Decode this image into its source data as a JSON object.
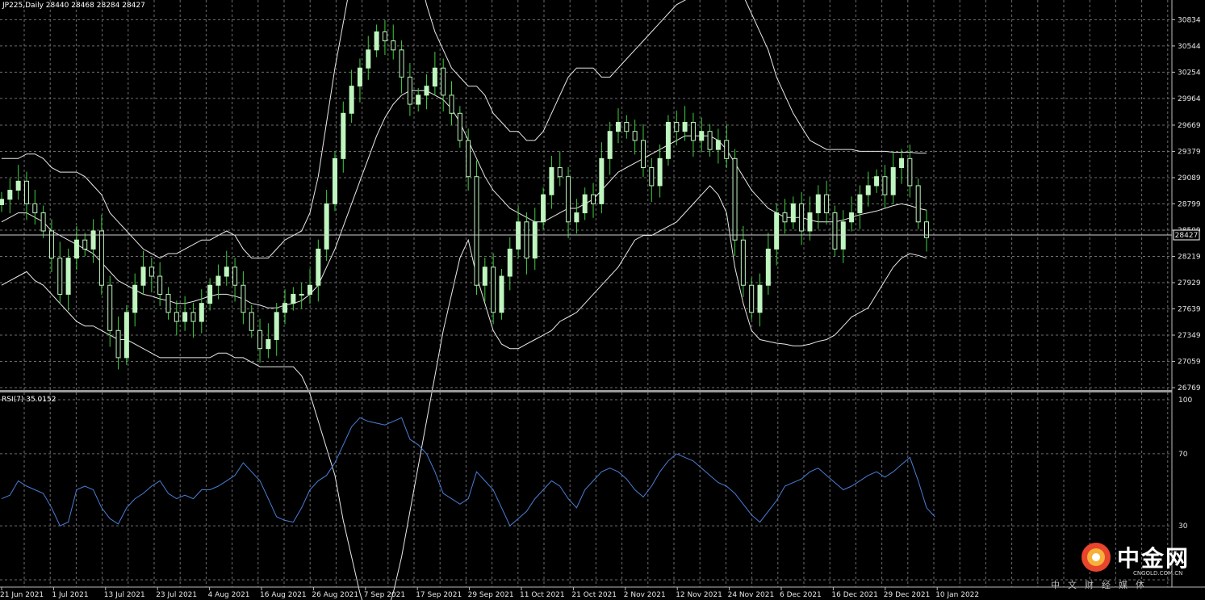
{
  "symbol_header": "JP225,Daily  28440 28468 28284 28427",
  "rsi_header": "RSI(7) 35.0152",
  "current_price_label": "28427",
  "colors": {
    "background": "#000000",
    "grid": "#6e6e6e",
    "candle": "#bff5bf",
    "candle_wick": "#3fcf3f",
    "bands": "#e8e8e8",
    "rsi_line": "#4a7fd6",
    "separator": "#b9b9b9"
  },
  "chart_data": [
    {
      "type": "candlestick",
      "title": "JP225,Daily",
      "ohlc_readout": {
        "open": 28440,
        "high": 28468,
        "low": 28284,
        "close": 28427
      },
      "ylim": [
        26769,
        30900
      ],
      "y_ticks": [
        26769,
        27059,
        27349,
        27639,
        27929,
        28219,
        28509,
        28799,
        29089,
        29379,
        29669,
        29964,
        30254,
        30544,
        30834
      ],
      "x_tick_labels": [
        "21 Jun 2021",
        "1 Jul 2021",
        "13 Jul 2021",
        "23 Jul 2021",
        "4 Aug 2021",
        "16 Aug 2021",
        "26 Aug 2021",
        "7 Sep 2021",
        "17 Sep 2021",
        "29 Sep 2021",
        "11 Oct 2021",
        "21 Oct 2021",
        "2 Nov 2021",
        "12 Nov 2021",
        "24 Nov 2021",
        "6 Dec 2021",
        "16 Dec 2021",
        "29 Dec 2021",
        "10 Jan 2022"
      ],
      "grid": true,
      "current_price": 28427,
      "closes": [
        28850,
        28950,
        29050,
        28800,
        28700,
        28500,
        28200,
        27800,
        28200,
        28400,
        28300,
        28500,
        27900,
        27400,
        27100,
        27600,
        27900,
        28100,
        28000,
        27800,
        27600,
        27500,
        27600,
        27500,
        27700,
        27900,
        28000,
        28100,
        27900,
        27600,
        27400,
        27200,
        27300,
        27600,
        27700,
        27800,
        27800,
        27900,
        28300,
        28800,
        29300,
        29800,
        30100,
        30300,
        30500,
        30700,
        30600,
        30500,
        30200,
        29900,
        30000,
        30100,
        30300,
        30000,
        29800,
        29500,
        29100,
        27900,
        28100,
        27600,
        28000,
        28300,
        28600,
        28200,
        28600,
        28900,
        29200,
        29100,
        28600,
        28700,
        28900,
        28800,
        29300,
        29600,
        29700,
        29600,
        29500,
        29200,
        29000,
        29300,
        29700,
        29600,
        29700,
        29500,
        29600,
        29400,
        29500,
        29300,
        28400,
        27900,
        27600,
        27900,
        28300,
        28700,
        28600,
        28800,
        28500,
        28700,
        28900,
        28700,
        28300,
        28600,
        28700,
        28900,
        29000,
        29100,
        28900,
        29200,
        29300,
        29000,
        28600,
        28427
      ],
      "indicator_bands": {
        "upper": [
          29300,
          29300,
          29300,
          29350,
          29350,
          29300,
          29200,
          29150,
          29150,
          29150,
          29100,
          29000,
          28900,
          28700,
          28600,
          28500,
          28400,
          28300,
          28250,
          28200,
          28250,
          28250,
          28300,
          28350,
          28400,
          28400,
          28450,
          28500,
          28450,
          28300,
          28200,
          28200,
          28200,
          28300,
          28400,
          28450,
          28500,
          28700,
          29100,
          29700,
          30300,
          30800,
          31300,
          31800,
          32200,
          32400,
          32400,
          32300,
          32100,
          31800,
          31400,
          31000,
          30700,
          30500,
          30300,
          30200,
          30100,
          30100,
          30000,
          29800,
          29700,
          29600,
          29600,
          29500,
          29500,
          29600,
          29800,
          30000,
          30200,
          30300,
          30300,
          30300,
          30200,
          30200,
          30300,
          30400,
          30500,
          30600,
          30700,
          30800,
          30900,
          31000,
          31050,
          31100,
          31100,
          31200,
          31300,
          31400,
          31300,
          31100,
          30900,
          30700,
          30500,
          30200,
          30000,
          29800,
          29650,
          29500,
          29450,
          29400,
          29400,
          29400,
          29400,
          29380,
          29380,
          29380,
          29380,
          29370,
          29370,
          29370,
          29360,
          29360
        ],
        "middle": [
          28600,
          28650,
          28700,
          28700,
          28650,
          28600,
          28500,
          28450,
          28400,
          28350,
          28300,
          28250,
          28150,
          28050,
          27950,
          27900,
          27850,
          27800,
          27780,
          27750,
          27730,
          27700,
          27700,
          27720,
          27750,
          27780,
          27800,
          27800,
          27780,
          27750,
          27700,
          27680,
          27650,
          27650,
          27680,
          27700,
          27730,
          27800,
          27900,
          28100,
          28300,
          28550,
          28800,
          29050,
          29300,
          29550,
          29750,
          29900,
          30000,
          30050,
          30050,
          30050,
          30000,
          29950,
          29850,
          29700,
          29500,
          29300,
          29100,
          28950,
          28850,
          28750,
          28700,
          28650,
          28600,
          28600,
          28650,
          28700,
          28750,
          28750,
          28800,
          28850,
          28950,
          29050,
          29150,
          29200,
          29250,
          29300,
          29350,
          29400,
          29450,
          29500,
          29550,
          29550,
          29550,
          29550,
          29500,
          29400,
          29250,
          29100,
          28950,
          28850,
          28750,
          28700,
          28650,
          28650,
          28650,
          28620,
          28600,
          28600,
          28600,
          28620,
          28650,
          28680,
          28700,
          28720,
          28750,
          28780,
          28800,
          28780,
          28750,
          28730
        ],
        "lower": [
          27900,
          27950,
          28000,
          28050,
          27950,
          27900,
          27800,
          27700,
          27600,
          27500,
          27450,
          27450,
          27400,
          27350,
          27300,
          27300,
          27250,
          27200,
          27150,
          27100,
          27100,
          27100,
          27100,
          27100,
          27100,
          27100,
          27150,
          27150,
          27100,
          27100,
          27050,
          27000,
          27000,
          27000,
          27000,
          27000,
          26900,
          26700,
          26400,
          26100,
          25800,
          25300,
          24900,
          24500,
          24200,
          24100,
          24200,
          24500,
          24900,
          25400,
          25900,
          26400,
          26900,
          27400,
          27800,
          28200,
          28400,
          28000,
          27700,
          27400,
          27250,
          27200,
          27200,
          27250,
          27300,
          27350,
          27400,
          27500,
          27550,
          27600,
          27700,
          27800,
          27900,
          28000,
          28100,
          28250,
          28400,
          28450,
          28450,
          28500,
          28550,
          28600,
          28700,
          28800,
          28900,
          29000,
          28900,
          28700,
          28100,
          27700,
          27400,
          27300,
          27280,
          27260,
          27250,
          27230,
          27230,
          27250,
          27280,
          27300,
          27350,
          27450,
          27550,
          27600,
          27650,
          27800,
          27950,
          28100,
          28200,
          28250,
          28230,
          28200
        ]
      }
    },
    {
      "type": "line",
      "title": "RSI(7) 35.0152",
      "ylim": [
        0,
        100
      ],
      "y_ticks": [
        0,
        30,
        70,
        100
      ],
      "current_value": 35.0152,
      "series": [
        {
          "values": [
            45,
            47,
            55,
            52,
            50,
            48,
            40,
            30,
            32,
            50,
            52,
            50,
            40,
            34,
            31,
            40,
            45,
            48,
            52,
            55,
            48,
            45,
            47,
            45,
            50,
            50,
            52,
            55,
            58,
            65,
            60,
            55,
            45,
            35,
            33,
            32,
            40,
            50,
            55,
            58,
            65,
            75,
            85,
            90,
            88,
            87,
            86,
            88,
            90,
            78,
            75,
            70,
            60,
            48,
            45,
            42,
            45,
            60,
            55,
            50,
            40,
            30,
            34,
            38,
            45,
            50,
            55,
            52,
            45,
            40,
            50,
            55,
            60,
            62,
            60,
            56,
            50,
            46,
            52,
            60,
            66,
            70,
            68,
            66,
            62,
            58,
            54,
            52,
            48,
            42,
            36,
            32,
            38,
            44,
            52,
            54,
            56,
            60,
            62,
            58,
            54,
            50,
            52,
            55,
            58,
            60,
            57,
            60,
            64,
            68,
            55,
            40,
            35
          ]
        }
      ]
    }
  ],
  "watermark": {
    "brand_cn": "中金网",
    "brand_url": "CNGOLD.COM.CN",
    "tagline": "中文财经媒体"
  }
}
